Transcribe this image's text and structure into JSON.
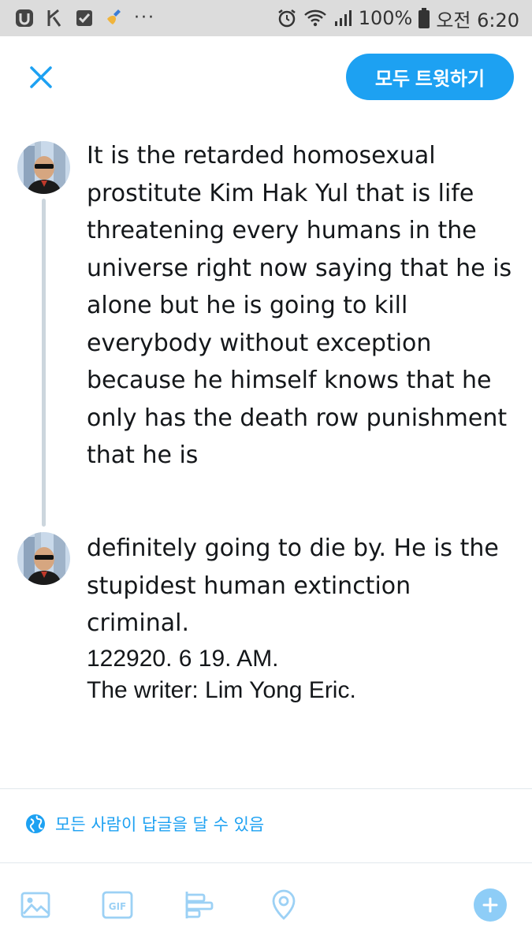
{
  "status_bar": {
    "notification_icons": [
      "u-app-icon",
      "lightning-icon",
      "checkbox-icon",
      "broom-icon"
    ],
    "more": "···",
    "battery_percent": "100%",
    "time": "오전 6:20"
  },
  "header": {
    "close_icon": "close-icon",
    "tweet_all_label": "모두 트윗하기"
  },
  "thread": [
    {
      "text": "It is the retarded homosexual\nprostitute Kim Hak Yul that is life\nthreatening every humans in the\nuniverse right now saying that he is\nalone but he is going to kill\neverybody without exception\nbecause he himself knows that he\nonly has the death row punishment\nthat he is"
    },
    {
      "text": "definitely going to die by.  He is the\nstupidest human extinction\ncriminal.",
      "extra": "122920.  6 19.  AM.\nThe writer:  Lim Yong Eric."
    }
  ],
  "reply_setting": {
    "icon": "globe-icon",
    "label": "모든 사람이 답글을 달 수 있음"
  },
  "toolbar": {
    "icons": [
      "image-icon",
      "gif-icon",
      "poll-icon",
      "location-icon"
    ],
    "gif_label": "GIF",
    "add_icon": "plus-icon"
  },
  "colors": {
    "accent": "#1da1f2",
    "accent_light": "#8ecdf7",
    "thread_line": "#ccd6dd",
    "status_bar_bg": "#dcdcdc",
    "icon_muted": "#9cd1f5"
  }
}
